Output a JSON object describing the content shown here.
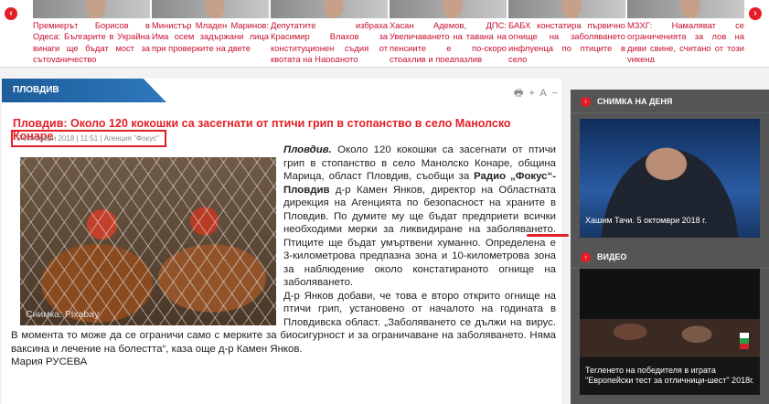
{
  "carousel": {
    "prev_icon": "chevron-left-icon",
    "next_icon": "chevron-right-icon",
    "items": [
      {
        "text": "Премиерът Борисов в Одеса: Българите в Украйна винаги ще бъдат мост за сътрудничество"
      },
      {
        "text": "Министър Младен Маринов: Има осем задържани лица при проверките на двете"
      },
      {
        "text": "Депутатите избраха Красимир Влахов за конституционен съдия от квотата на Народното"
      },
      {
        "text": "Хасан Адемов, ДПС: Увеличаването на тавана на пенсиите е по-скоро страхлив и предпазлив"
      },
      {
        "text": "БАБХ констатира първично огнище на заболяването инфлуенца по птиците в село"
      },
      {
        "text": "МЗХГ: Намаляват се ограниченията за лов на диви свине, считано от този уикенд"
      }
    ]
  },
  "section": {
    "title": "ПЛОВДИВ",
    "tools": [
      "🖶",
      "+",
      "A",
      "−"
    ]
  },
  "article": {
    "headline": "Пловдив: Около 120 кокошки са засегнати от птичи грип в стопанство в село Манолско Конаре",
    "meta": "5 Октомври 2018 | 11:51 | Агенция \"Фокус\"",
    "photo_caption": "Снимка: Pixabay",
    "lead_city": "Пловдив.",
    "p1a": " Около 120 кокошки са засегнати от птичи грип в стопанство в село Манолско Конаре, община Марица, област Пловдив, съобщи за ",
    "p1_bold": "Радио „Фокус“-Пловдив",
    "p1b": " д-р Камен Янков, директор на Областната дирекция на Агенцията по безопасност на храните в Пловдив. По думите му ще бъдат предприети всички необходими мерки за ликвидиране на заболяването. Птиците ще бъдат умъртвени хуманно. Определена е 3-километрова предпазна зона и 10-километрова зона за наблюдение около констатираното огнище на заболяването.",
    "p2": "Д-р Янков добави, че това е второ открито огнище на птичи грип, установено от началото на годината в Пловдивска област. „Заболяването се дължи на вирус. В момента то може да се ограничи само с мерките за биосигурност и за ограничаване на заболяването. Няма ваксина и лечение на болестта“, каза още д-р Камен Янков.",
    "author": "Мария РУСЕВА"
  },
  "photo_of_day": {
    "title": "СНИМКА НА ДЕНЯ",
    "caption": "Хашим Тачи. 5 октомври 2018 г.",
    "icon": "chevron-right-icon"
  },
  "video": {
    "title": "ВИДЕО",
    "caption": "Тегленето на победителя в играта \"Европейски тест за отличници-шест\" 2018г.",
    "icon": "chevron-right-icon"
  },
  "colors": {
    "accent": "#e41e26",
    "section_blue": "#1d5d9a",
    "sidebar_bg": "#555555"
  }
}
